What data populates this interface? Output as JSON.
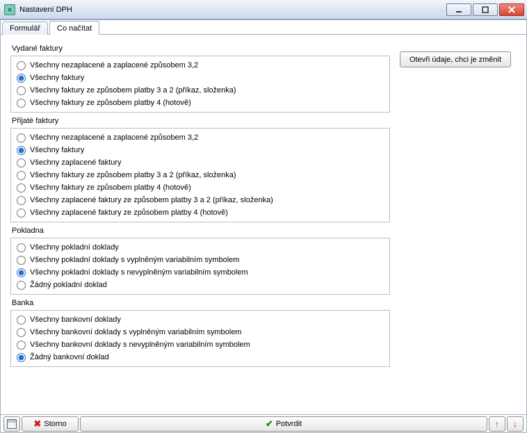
{
  "window": {
    "title": "Nastavení DPH"
  },
  "tabs": {
    "formular": "Formulář",
    "conacitat": "Co načítat"
  },
  "side_button": "Otevři údaje, chci je změnit",
  "groups": {
    "vydane": {
      "label": "Vydané faktury",
      "options": [
        "Všechny nezaplacené  a zaplacené způsobem 3,2",
        "Všechny faktury",
        "Všechny faktury ze způsobem platby 3 a 2 (příkaz, složenka)",
        "Všechny faktury ze způsobem platby 4 (hotově)"
      ],
      "selected": 1
    },
    "prijate": {
      "label": "Přijaté faktury",
      "options": [
        "Všechny nezaplacené  a zaplacené způsobem 3,2",
        "Všechny faktury",
        "Všechny zaplacené faktury",
        "Všechny faktury ze způsobem platby 3 a 2 (příkaz, složenka)",
        "Všechny faktury ze způsobem platby 4 (hotově)",
        "Všechny zaplacené faktury ze způsobem platby 3 a 2 (příkaz, složenka)",
        "Všechny zaplacené faktury ze způsobem platby 4 (hotově)"
      ],
      "selected": 1
    },
    "pokladna": {
      "label": "Pokladna",
      "options": [
        "Všechny pokladní doklady",
        "Všechny pokladní doklady s vyplněným variabilním symbolem",
        "Všechny pokladní doklady s nevyplněným variabilním symbolem",
        "Žádný pokladní doklad"
      ],
      "selected": 2
    },
    "banka": {
      "label": "Banka",
      "options": [
        "Všechny bankovní doklady",
        "Všechny bankovní doklady s vyplněným variabilním symbolem",
        "Všechny bankovní doklady s nevyplněným variabilním symbolem",
        "Žádný bankovní doklad"
      ],
      "selected": 3
    }
  },
  "bottom": {
    "storno": "Storno",
    "confirm": "Potvrdit"
  }
}
